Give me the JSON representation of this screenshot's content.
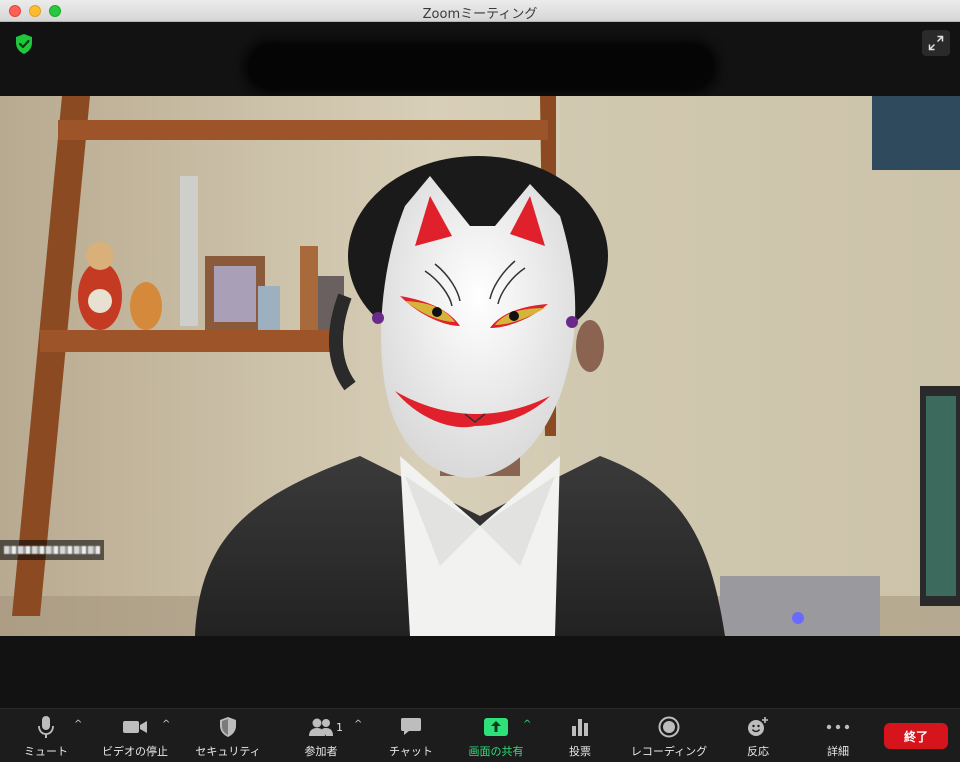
{
  "window": {
    "title": "Zoomミーティング"
  },
  "participant": {
    "name_redacted": true
  },
  "toolbar": {
    "mute_label": "ミュート",
    "video_label": "ビデオの停止",
    "security_label": "セキュリティ",
    "participants_label": "参加者",
    "participants_count": "1",
    "chat_label": "チャット",
    "share_label": "画面の共有",
    "poll_label": "投票",
    "record_label": "レコーディング",
    "reaction_label": "反応",
    "more_label": "詳細",
    "end_label": "終了"
  },
  "colors": {
    "share_green": "#2ee07a",
    "end_red": "#d5141b",
    "shield_green": "#1fc73b"
  }
}
